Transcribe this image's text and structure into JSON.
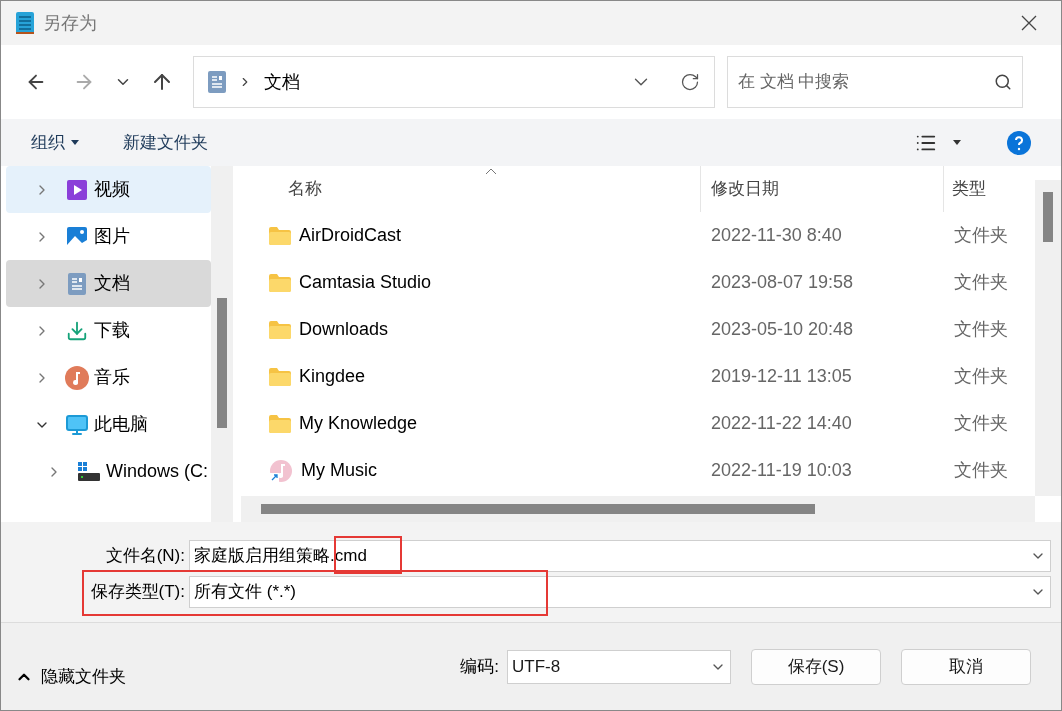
{
  "window": {
    "title": "另存为"
  },
  "nav": {
    "path": "文档",
    "search": {
      "placeholder": "在 文档 中搜索"
    }
  },
  "toolbar": {
    "organize": "组织",
    "new_folder": "新建文件夹"
  },
  "sidebar": {
    "items": [
      {
        "label": "视频",
        "kind": "video",
        "selected": false,
        "hovered": true,
        "expanded": false
      },
      {
        "label": "图片",
        "kind": "pictures",
        "selected": false,
        "hovered": false,
        "expanded": false
      },
      {
        "label": "文档",
        "kind": "documents",
        "selected": true,
        "hovered": false,
        "expanded": false
      },
      {
        "label": "下载",
        "kind": "download",
        "selected": false,
        "hovered": false,
        "expanded": false
      },
      {
        "label": "音乐",
        "kind": "music",
        "selected": false,
        "hovered": false,
        "expanded": false
      },
      {
        "label": "此电脑",
        "kind": "pc",
        "selected": false,
        "hovered": false,
        "expanded": true,
        "children": [
          {
            "label": "Windows (C:",
            "kind": "drive",
            "selected": false,
            "hovered": false,
            "expanded": false
          }
        ]
      }
    ]
  },
  "table": {
    "columns": [
      "名称",
      "修改日期",
      "类型"
    ],
    "rows": [
      {
        "kind": "folder",
        "name": "AirDroidCast",
        "date": "2022-11-30 8:40",
        "type": "文件夹"
      },
      {
        "kind": "folder",
        "name": "Camtasia Studio",
        "date": "2023-08-07 19:58",
        "type": "文件夹"
      },
      {
        "kind": "folder",
        "name": "Downloads",
        "date": "2023-05-10 20:48",
        "type": "文件夹"
      },
      {
        "kind": "folder",
        "name": "Kingdee",
        "date": "2019-12-11 13:05",
        "type": "文件夹"
      },
      {
        "kind": "folder",
        "name": "My Knowledge",
        "date": "2022-11-22 14:40",
        "type": "文件夹"
      },
      {
        "kind": "music",
        "name": "My Music",
        "date": "2022-11-19 10:03",
        "type": "文件夹"
      }
    ]
  },
  "form": {
    "fields": [
      {
        "label": "文件名(N):",
        "value": "家庭版启用组策略.cmd",
        "highlighted": true
      },
      {
        "label": "保存类型(T):",
        "value": "所有文件  (*.*)",
        "highlighted": true
      }
    ]
  },
  "footer": {
    "hide_folders": "隐藏文件夹",
    "encoding_label": "编码:",
    "encoding": "UTF-8",
    "save": "保存(S)",
    "cancel": "取消"
  }
}
